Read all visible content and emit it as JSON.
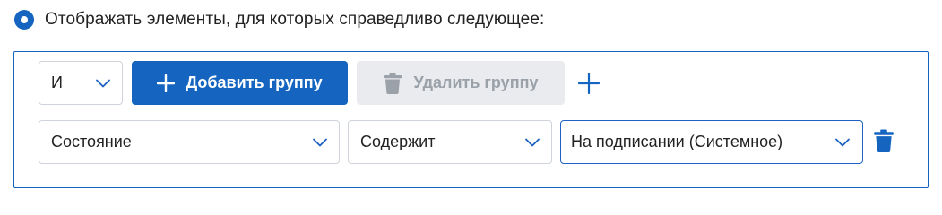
{
  "filter_mode": {
    "label": "Отображать элементы, для которых справедливо следующее:",
    "selected": true
  },
  "group": {
    "operator": {
      "value": "И"
    },
    "add_group_label": "Добавить группу",
    "delete_group_label": "Удалить группу",
    "delete_group_disabled": true
  },
  "condition": {
    "field": {
      "value": "Состояние"
    },
    "operator": {
      "value": "Содержит"
    },
    "value": {
      "value": "На подписании (Системное)"
    }
  },
  "colors": {
    "accent": "#1565c0",
    "border": "#cfd4da",
    "disabled_bg": "#e9ebee",
    "disabled_text": "#9aa1a9"
  },
  "icons": {
    "radio": "radio-selected-icon",
    "chevron": "chevron-down-icon",
    "add": "plus-icon",
    "delete_group": "trash-icon",
    "add_condition": "plus-icon",
    "delete_condition": "trash-icon"
  }
}
